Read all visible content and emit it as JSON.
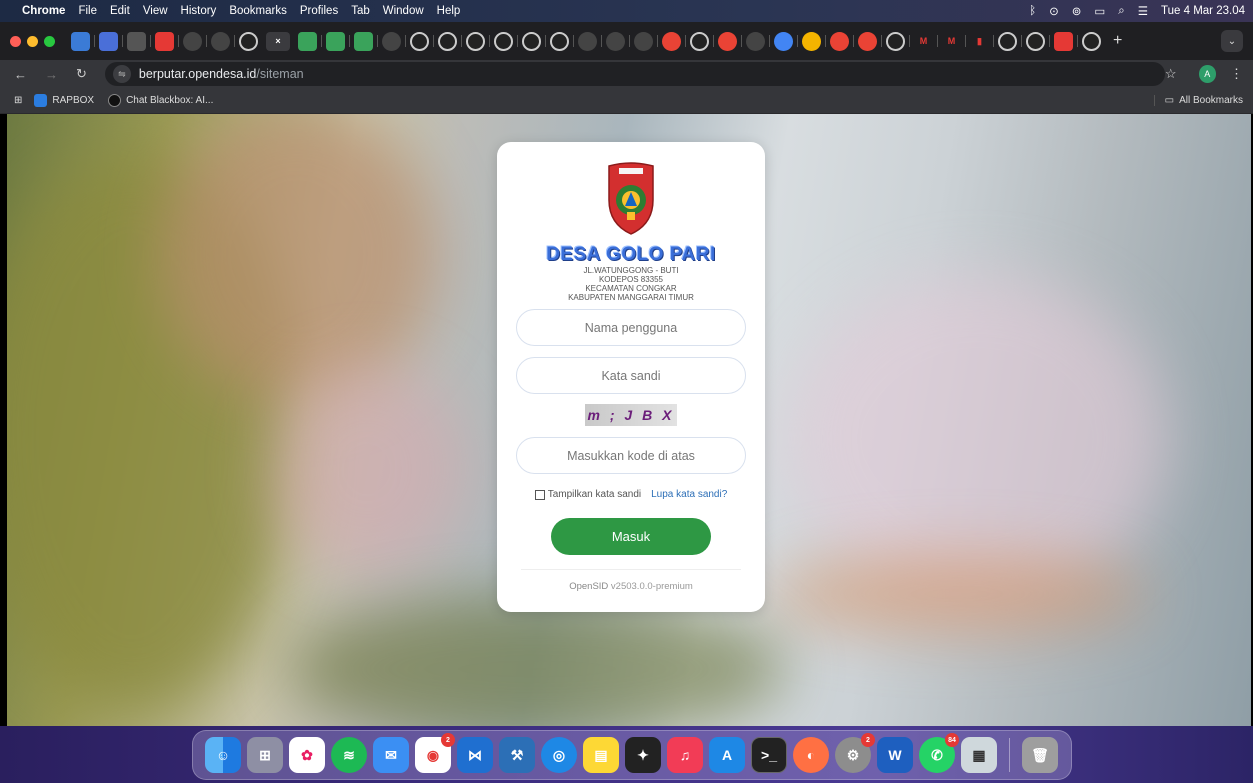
{
  "menubar": {
    "apple": "",
    "items": [
      "Chrome",
      "File",
      "Edit",
      "View",
      "History",
      "Bookmarks",
      "Profiles",
      "Tab",
      "Window",
      "Help"
    ],
    "clock": "Tue 4 Mar 23.04"
  },
  "tabs": {
    "new_tab_label": "+",
    "active_close": "×",
    "menu_glyph": "⌄"
  },
  "address": {
    "domain": "berputar.opendesa.id",
    "path": "/siteman",
    "avatar_letter": "A"
  },
  "bookmarks": {
    "items": [
      "RAPBOX",
      "Chat Blackbox: AI..."
    ],
    "all_label": "All Bookmarks"
  },
  "login": {
    "village_name": "DESA GOLO PARI",
    "address_lines": [
      "JL.WATUNGGONG - BUTI",
      "KODEPOS 83355",
      "KECAMATAN CONGKAR",
      "KABUPATEN MANGGARAI TIMUR"
    ],
    "username_placeholder": "Nama pengguna",
    "password_placeholder": "Kata sandi",
    "captcha_text": "m ; J B X",
    "captcha_placeholder": "Masukkan kode di atas",
    "show_password_label": "Tampilkan kata sandi",
    "forgot_label": "Lupa kata sandi?",
    "submit_label": "Masuk",
    "footer_brand": "OpenSID",
    "footer_version": "v2503.0.0-premium"
  },
  "dock": {
    "badges": {
      "chrome": "2",
      "whatsapp": "84"
    }
  },
  "colors": {
    "submit": "#2e9844",
    "link": "#2d6fb7",
    "village_name": "#3a6ed8"
  }
}
